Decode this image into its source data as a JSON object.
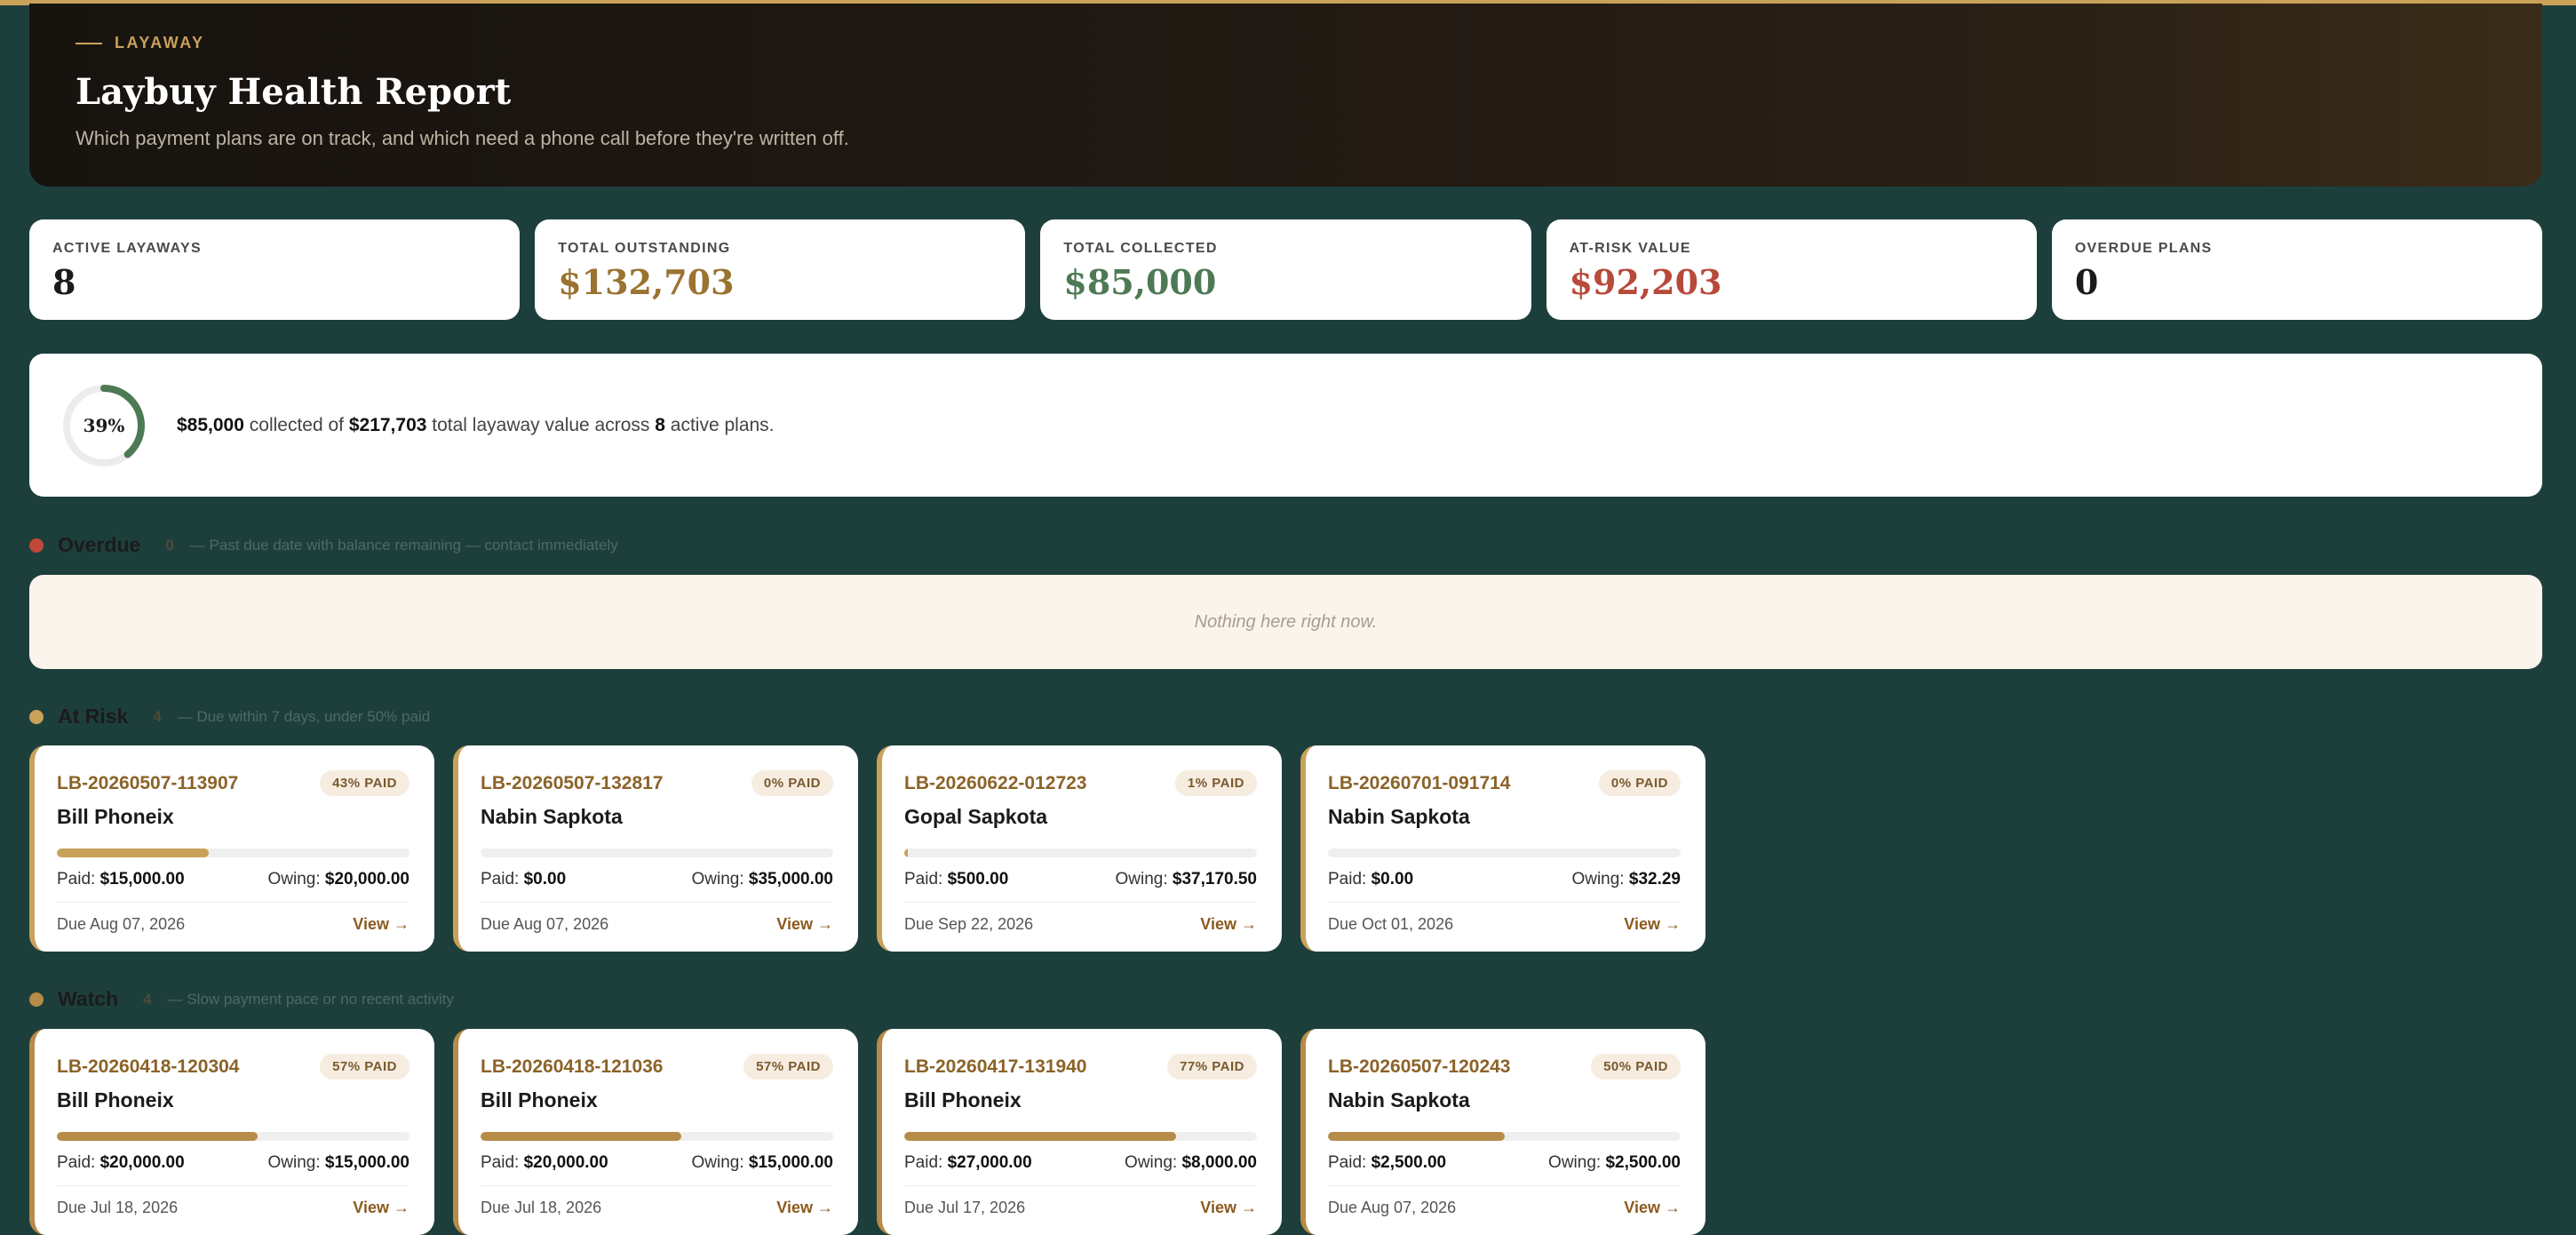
{
  "header": {
    "eyebrow": "LAYAWAY",
    "title": "Laybuy Health Report",
    "subtitle": "Which payment plans are on track, and which need a phone call before they're written off."
  },
  "stats": [
    {
      "label": "ACTIVE LAYAWAYS",
      "value": "8",
      "color": "#1b1b1b"
    },
    {
      "label": "TOTAL OUTSTANDING",
      "value": "$132,703",
      "color": "#9a7330"
    },
    {
      "label": "TOTAL COLLECTED",
      "value": "$85,000",
      "color": "#4d7a55"
    },
    {
      "label": "AT-RISK VALUE",
      "value": "$92,203",
      "color": "#b84a3a"
    },
    {
      "label": "OVERDUE PLANS",
      "value": "0",
      "color": "#1b1b1b"
    }
  ],
  "progress": {
    "percent_label": "39%",
    "percent": 39,
    "collected": "$85,000",
    "text1": "collected of",
    "total": "$217,703",
    "text2": "total layaway value across",
    "plans": "8",
    "text3": "active plans."
  },
  "sections": {
    "overdue": {
      "title": "Overdue",
      "count": "0",
      "desc": "— Past due date with balance remaining — contact immediately",
      "empty": "Nothing here right now.",
      "color": "#c0493a"
    },
    "at_risk": {
      "title": "At Risk",
      "count": "4",
      "desc": "— Due within 7 days, under 50% paid",
      "color": "#c9a25a"
    },
    "watch": {
      "title": "Watch",
      "count": "4",
      "desc": "— Slow payment pace or no recent activity",
      "color": "#b78b48"
    }
  },
  "labels": {
    "paid": "Paid:",
    "owing": "Owing:",
    "view": "View →"
  },
  "at_risk_cards": [
    {
      "id": "LB-20260507-113907",
      "badge": "43% PAID",
      "pct": 43,
      "customer": "Bill Phoneix",
      "paid": "$15,000.00",
      "owing": "$20,000.00",
      "due": "Due Aug 07, 2026"
    },
    {
      "id": "LB-20260507-132817",
      "badge": "0% PAID",
      "pct": 0,
      "customer": "Nabin Sapkota",
      "paid": "$0.00",
      "owing": "$35,000.00",
      "due": "Due Aug 07, 2026"
    },
    {
      "id": "LB-20260622-012723",
      "badge": "1% PAID",
      "pct": 1,
      "customer": "Gopal Sapkota",
      "paid": "$500.00",
      "owing": "$37,170.50",
      "due": "Due Sep 22, 2026"
    },
    {
      "id": "LB-20260701-091714",
      "badge": "0% PAID",
      "pct": 0,
      "customer": "Nabin Sapkota",
      "paid": "$0.00",
      "owing": "$32.29",
      "due": "Due Oct 01, 2026"
    }
  ],
  "watch_cards": [
    {
      "id": "LB-20260418-120304",
      "badge": "57% PAID",
      "pct": 57,
      "customer": "Bill Phoneix",
      "paid": "$20,000.00",
      "owing": "$15,000.00",
      "due": "Due Jul 18, 2026"
    },
    {
      "id": "LB-20260418-121036",
      "badge": "57% PAID",
      "pct": 57,
      "customer": "Bill Phoneix",
      "paid": "$20,000.00",
      "owing": "$15,000.00",
      "due": "Due Jul 18, 2026"
    },
    {
      "id": "LB-20260417-131940",
      "badge": "77% PAID",
      "pct": 77,
      "customer": "Bill Phoneix",
      "paid": "$27,000.00",
      "owing": "$8,000.00",
      "due": "Due Jul 17, 2026"
    },
    {
      "id": "LB-20260507-120243",
      "badge": "50% PAID",
      "pct": 50,
      "customer": "Nabin Sapkota",
      "paid": "$2,500.00",
      "owing": "$2,500.00",
      "due": "Due Aug 07, 2026"
    }
  ]
}
